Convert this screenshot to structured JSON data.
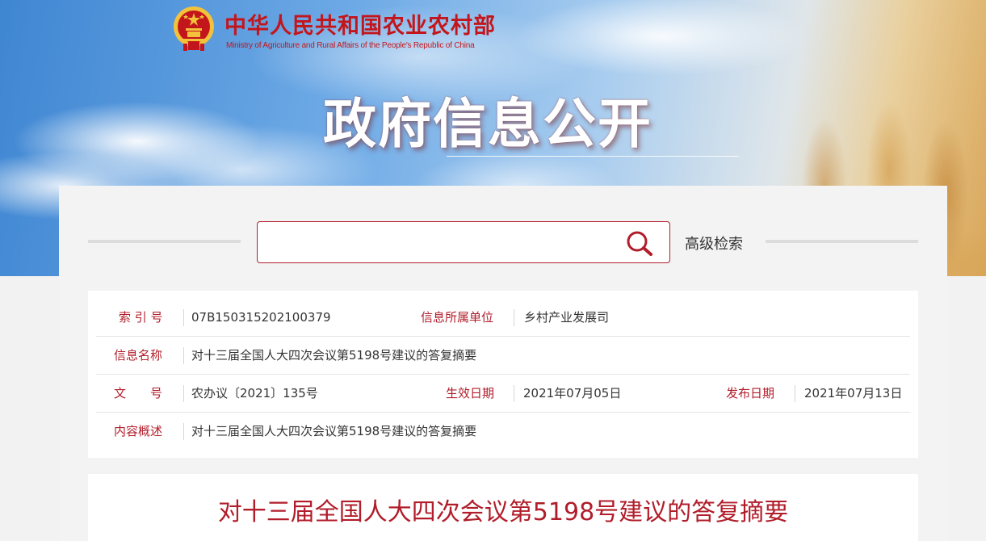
{
  "header": {
    "ministry_name_cn": "中华人民共和国农业农村部",
    "ministry_name_en": "Ministry of Agriculture and Rural Affairs of the People's Republic of China",
    "page_heading": "政府信息公开"
  },
  "search": {
    "value": "",
    "placeholder": "",
    "advanced_label": "高级检索"
  },
  "metadata": {
    "index_label": "索 引 号",
    "index_value": "07B150315202100379",
    "unit_label": "信息所属单位",
    "unit_value": "乡村产业发展司",
    "name_label": "信息名称",
    "name_value": "对十三届全国人大四次会议第5198号建议的答复摘要",
    "doc_no_label": "文　　号",
    "doc_no_value": "农办议〔2021〕135号",
    "effective_label": "生效日期",
    "effective_value": "2021年07月05日",
    "publish_label": "发布日期",
    "publish_value": "2021年07月13日",
    "summary_label": "内容概述",
    "summary_value": "对十三届全国人大四次会议第5198号建议的答复摘要"
  },
  "document": {
    "title": "对十三届全国人大四次会议第5198号建议的答复摘要"
  },
  "colors": {
    "accent_red": "#b11d2a",
    "emblem_red": "#c3161c",
    "emblem_gold": "#f2c23a"
  }
}
